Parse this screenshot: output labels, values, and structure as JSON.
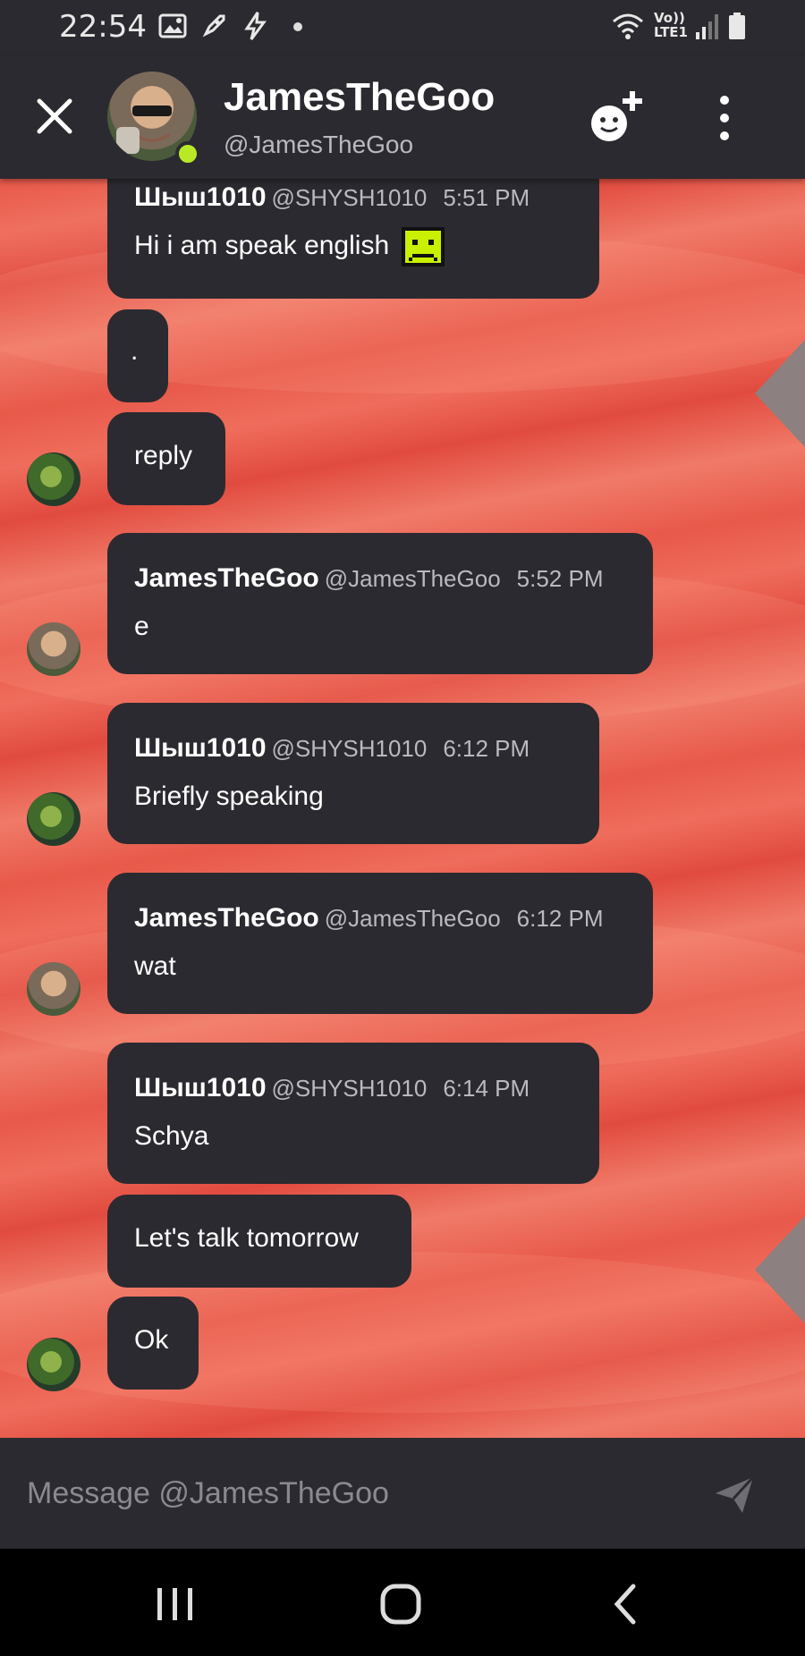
{
  "status_bar": {
    "time": "22:54",
    "network_top": "Vo))",
    "network_bottom": "LTE1"
  },
  "header": {
    "display_name": "JamesTheGoo",
    "handle": "@JamesTheGoo",
    "online_color": "#b7ea25"
  },
  "messages": [
    {
      "sender": "Шыш1010",
      "handle": "@SHYSH1010",
      "time": "5:51 PM",
      "text": "Hi i am speak english",
      "emoji": "frown-square-emoji"
    },
    {
      "text": "."
    },
    {
      "text": "reply"
    },
    {
      "sender": "JamesTheGoo",
      "handle": "@JamesTheGoo",
      "time": "5:52 PM",
      "text": "e"
    },
    {
      "sender": "Шыш1010",
      "handle": "@SHYSH1010",
      "time": "6:12 PM",
      "text": "Briefly speaking"
    },
    {
      "sender": "JamesTheGoo",
      "handle": "@JamesTheGoo",
      "time": "6:12 PM",
      "text": "wat"
    },
    {
      "sender": "Шыш1010",
      "handle": "@SHYSH1010",
      "time": "6:14 PM",
      "text": "Schya"
    },
    {
      "text": "Let's talk tomorrow"
    },
    {
      "text": "Ok"
    }
  ],
  "composer": {
    "placeholder": "Message @JamesTheGoo"
  },
  "colors": {
    "surface": "#2b2a30",
    "background_accent": "#e8594a",
    "muted_text": "#b9b9bf"
  }
}
